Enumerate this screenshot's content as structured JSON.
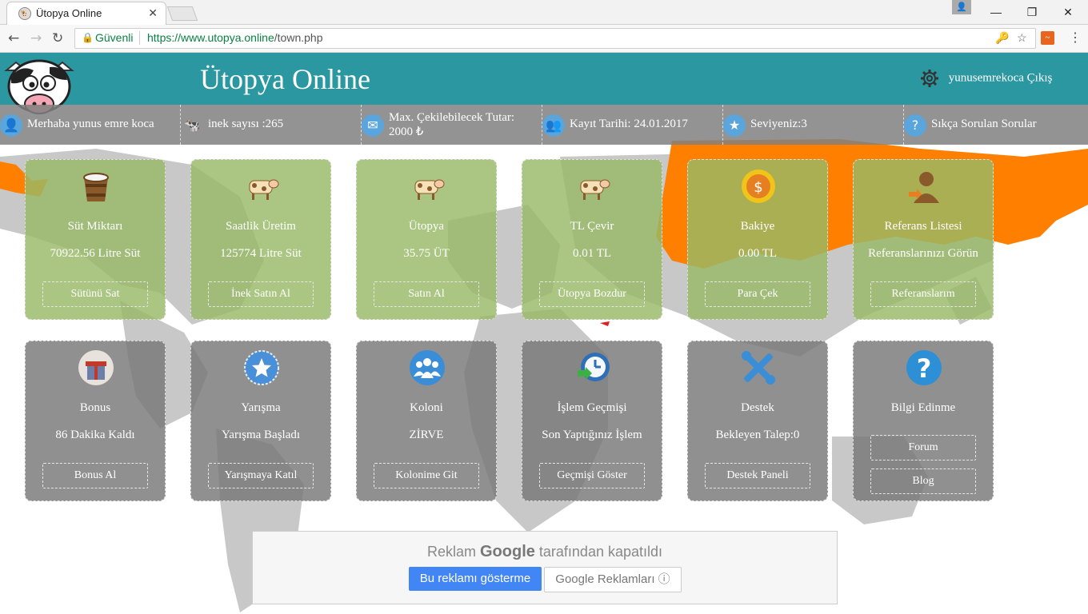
{
  "browser": {
    "tab_title": "Ütopya Online",
    "secure_label": "Güvenli",
    "url_host": "https://www.utopya.online",
    "url_path": "/town.php"
  },
  "header": {
    "site_title": "Ütopya Online",
    "username": "yunusemrekoca",
    "logout": "Çıkış"
  },
  "info": [
    {
      "text": "Merhaba yunus emre koca",
      "icon": "user-icon"
    },
    {
      "text": "inek sayısı :265",
      "icon": "cow-icon"
    },
    {
      "text": "Max. Çekilebilecek Tutar:",
      "text2": "2000 ₺",
      "icon": "mail-icon"
    },
    {
      "text": "Kayıt Tarihi: 24.01.2017",
      "icon": "group-icon"
    },
    {
      "text": "Seviyeniz:3",
      "icon": "star-icon"
    },
    {
      "text": "Sıkça Sorulan Sorular",
      "icon": "question-icon"
    }
  ],
  "cards": [
    {
      "title": "Süt Miktarı",
      "value": "70922.56 Litre Süt",
      "button": "Sütünü Sat",
      "icon": "milk-bucket-icon"
    },
    {
      "title": "Saatlik Üretim",
      "value": "125774 Litre Süt",
      "button": "İnek Satın Al",
      "icon": "cow-icon"
    },
    {
      "title": "Ütopya",
      "value": "35.75 ÜT",
      "button": "Satın Al",
      "icon": "cow-icon"
    },
    {
      "title": "TL Çevir",
      "value": "0.01 TL",
      "button": "Ütopya Bozdur",
      "icon": "cow-icon"
    },
    {
      "title": "Bakiye",
      "value": "0.00 TL",
      "button": "Para Çek",
      "icon": "coin-icon"
    },
    {
      "title": "Referans Listesi",
      "value": "Referanslarınızı Görün",
      "button": "Referanslarım",
      "icon": "referral-icon"
    },
    {
      "title": "Bonus",
      "value": "86 Dakika Kaldı",
      "button": "Bonus Al",
      "icon": "gift-icon"
    },
    {
      "title": "Yarışma",
      "value": "Yarışma Başladı",
      "button": "Yarışmaya Katıl",
      "icon": "star-icon"
    },
    {
      "title": "Koloni",
      "value": "ZİRVE",
      "button": "Kolonime Git",
      "icon": "group-icon"
    },
    {
      "title": "İşlem Geçmişi",
      "value": "Son Yaptığınız İşlem",
      "button": "Geçmişi Göster",
      "icon": "history-icon"
    },
    {
      "title": "Destek",
      "value": "Bekleyen Talep:0",
      "button": "Destek Paneli",
      "icon": "tools-icon"
    },
    {
      "title": "Bilgi Edinme",
      "button1": "Forum",
      "button2": "Blog",
      "icon": "question-icon"
    }
  ],
  "ad": {
    "prefix": "Reklam",
    "brand": "Google",
    "suffix": "tarafından kapatıldı",
    "stop_button": "Bu reklamı gösterme",
    "info_button": "Google Reklamları ⓘ"
  }
}
